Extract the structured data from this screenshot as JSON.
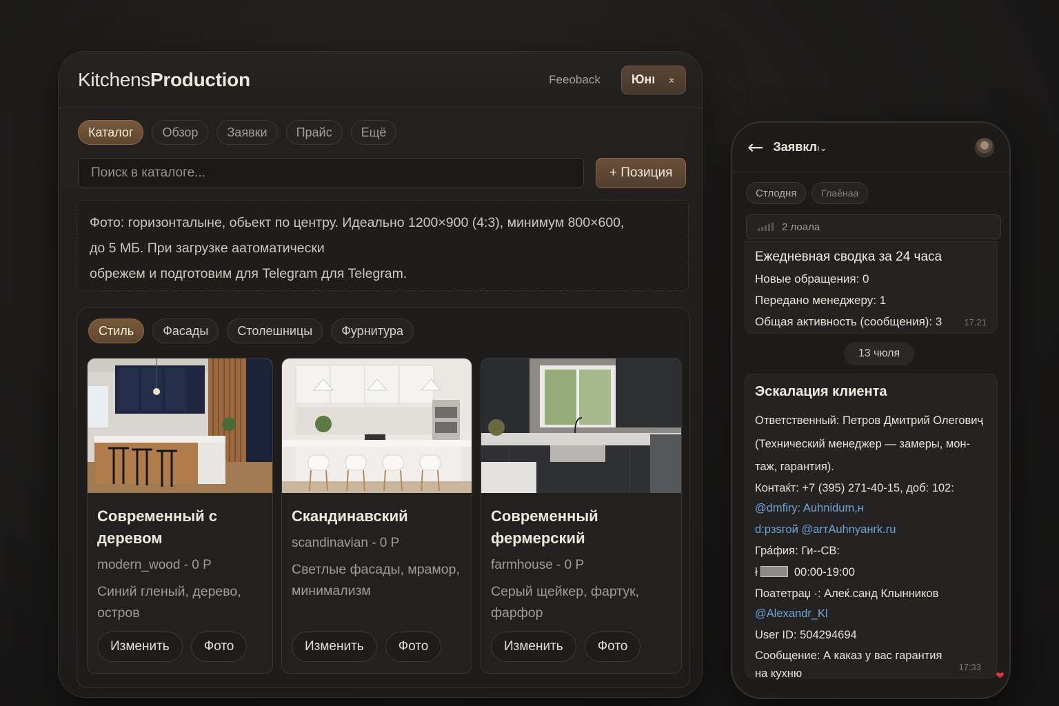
{
  "admin": {
    "brand_light": "Kitchens",
    "brand_bold": "Production",
    "feedback": "Feeoback",
    "user_label": "Юнı",
    "user_chevron": "⌅",
    "tabs": [
      "Каталог",
      "Обзор",
      "Заявки",
      "Прайс",
      "Ещё"
    ],
    "active_tab": "Каталог",
    "search_placeholder": "Поиск в каталоге...",
    "add_button": "+ Позиция",
    "info_lines": [
      "Фото: горизонталыне, обьект по центру. Идеально 1200×900 (4:3), минимум 800×600,",
      "до 5 МБ. При загрузке аатоматически",
      "обрежем и подготовим для Telegram для Telegram."
    ],
    "category_tabs": [
      "Стиль",
      "Фасады",
      "Столешницы",
      "Фурнитура"
    ],
    "active_category": "Стиль",
    "cards": [
      {
        "title": "Современный с деревом",
        "code": "modern_wood - 0 Р",
        "description": "Синий гленый, дерево, остров",
        "edit_label": "Изменить",
        "photo_label": "Фото",
        "image_icon": "modern-wood-kitchen-photo"
      },
      {
        "title": "Скандинавский",
        "code": "scandinavian - 0 Р",
        "description": "Светлые фасады, мрамор, минимализм",
        "edit_label": "Изменить",
        "photo_label": "Фото",
        "image_icon": "scandinavian-kitchen-photo"
      },
      {
        "title": "Современный фермерский",
        "code": "farmhouse - 0 Р",
        "description": "Серый щейкер, фартук, фарфор",
        "edit_label": "Изменить",
        "photo_label": "Фото",
        "image_icon": "farmhouse-kitchen-photo"
      }
    ]
  },
  "phone": {
    "back_icon": "←",
    "title": "Заявкл",
    "title_suffix": "ı⌄",
    "tabs": [
      "Стлодня",
      "Глаӗнаа"
    ],
    "banner": "2 лоала",
    "daily": {
      "heading": "Ежедневная сводка за 24 часа",
      "lines": [
        "Новые обращения: 0",
        "Передано менеджеру: 1",
        "Общая активность (сообщения): 3"
      ],
      "time": "17.21"
    },
    "date_chip": "13 чюля",
    "escalation": {
      "heading": "Эскалация клиента",
      "lines": [
        "Ответственный: Петров Дмитрий Олеговиҷ",
        "(Технический менеджер — замеры, мон-",
        "таж, гарантия).",
        "Контаќт: +7 (395) 271-40-15, доб: 102:",
        "@dmfiry: Auhnidum,н",
        "d:pзsгой @arтAuhnyaнrk.ru",
        "Гра́фия: Ги--СВ:",
        "00:00-19:00",
        "Поатетраџ ·: Алеќ.санд Клынников",
        "@Alexandr_Kl",
        "User ID: 504294694",
        "Сообщение: А каказ у вас гарантия",
        "на кухню"
      ],
      "hours_prefix": "ł",
      "time": "17:33",
      "reaction": "❤"
    }
  },
  "colors": {
    "accent": "#6b5039",
    "link": "#6da3d6",
    "background": "#1c1b1a"
  }
}
